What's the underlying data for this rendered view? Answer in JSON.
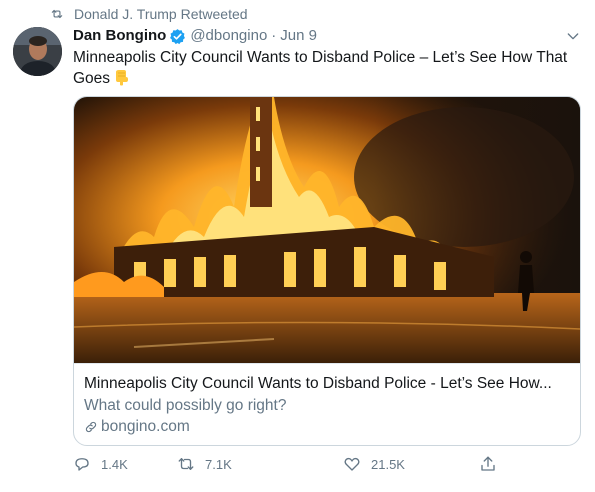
{
  "retweet": {
    "text": "Donald J. Trump Retweeted",
    "icon": "retweet-icon"
  },
  "author": {
    "display_name": "Dan Bongino",
    "handle": "@dbongino",
    "separator": "·",
    "date": "Jun 9",
    "verified_color": "#1da1f2"
  },
  "tweet": {
    "text": "Minneapolis City Council Wants to Disband Police – Let’s See How That Goes",
    "emoji": "👇"
  },
  "card": {
    "title": "Minneapolis City Council Wants to Disband Police - Let’s See How...",
    "description": "What could possibly go right?",
    "domain": "bongino.com",
    "image_subject": "burning building at night"
  },
  "actions": {
    "reply": {
      "count": "1.4K",
      "icon": "reply-icon"
    },
    "retweet": {
      "count": "7.1K",
      "icon": "retweet-icon"
    },
    "like": {
      "count": "21.5K",
      "icon": "heart-icon"
    },
    "share": {
      "icon": "share-icon"
    }
  },
  "colors": {
    "secondary_text": "#657786",
    "primary_text": "#14171a",
    "accent": "#1da1f2"
  }
}
